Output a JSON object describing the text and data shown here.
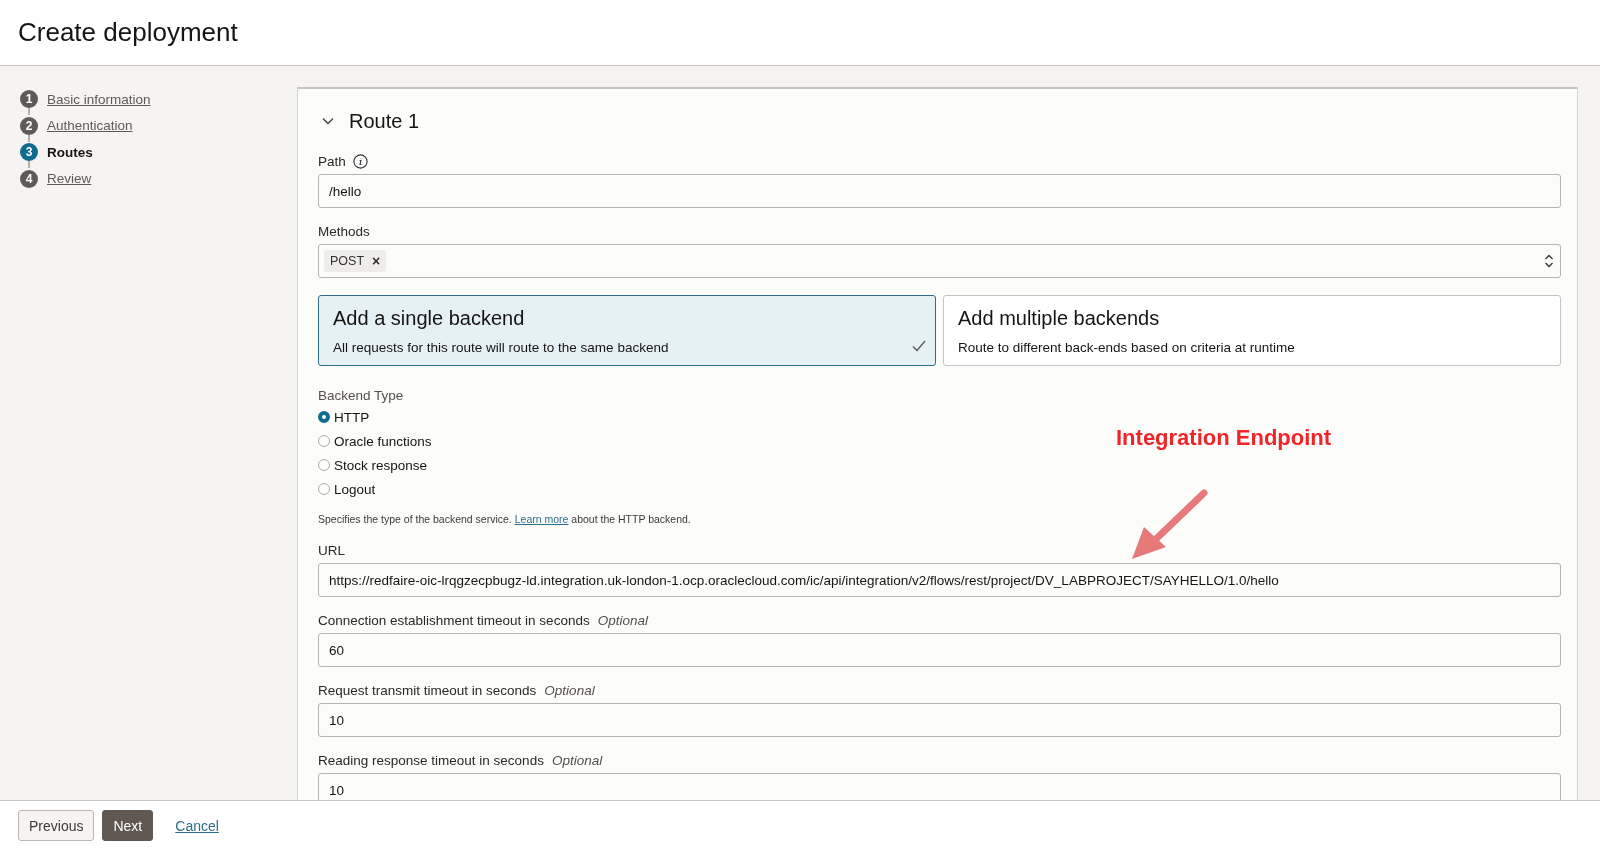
{
  "page": {
    "title": "Create deployment"
  },
  "steps": [
    {
      "number": "1",
      "label": "Basic information",
      "selected": false
    },
    {
      "number": "2",
      "label": "Authentication",
      "selected": false
    },
    {
      "number": "3",
      "label": "Routes",
      "selected": true
    },
    {
      "number": "4",
      "label": "Review",
      "selected": false
    }
  ],
  "route": {
    "title": "Route 1",
    "expanded": true,
    "path": {
      "label": "Path",
      "value": "/hello"
    },
    "methods": {
      "label": "Methods",
      "chips": [
        {
          "label": "POST",
          "remove": "×"
        }
      ]
    },
    "backend_options": [
      {
        "title": "Add a single backend",
        "description": "All requests for this route will route to the same backend",
        "selected": true
      },
      {
        "title": "Add multiple backends",
        "description": "Route to different back-ends based on criteria at runtime",
        "selected": false
      }
    ],
    "backend_type": {
      "label": "Backend Type",
      "options": [
        {
          "label": "HTTP",
          "selected": true
        },
        {
          "label": "Oracle functions",
          "selected": false
        },
        {
          "label": "Stock response",
          "selected": false
        },
        {
          "label": "Logout",
          "selected": false
        }
      ],
      "help_before": "Specifies the type of the backend service. ",
      "help_link": "Learn more",
      "help_after": " about the HTTP backend."
    },
    "url": {
      "label": "URL",
      "value": "https://redfaire-oic-lrqgzecpbugz-ld.integration.uk-london-1.ocp.oraclecloud.com/ic/api/integration/v2/flows/rest/project/DV_LABPROJECT/SAYHELLO/1.0/hello"
    },
    "timeouts": [
      {
        "label": "Connection establishment timeout in seconds",
        "optional": "Optional",
        "value": "60"
      },
      {
        "label": "Request transmit timeout in seconds",
        "optional": "Optional",
        "value": "10"
      },
      {
        "label": "Reading response timeout in seconds",
        "optional": "Optional",
        "value": "10"
      }
    ]
  },
  "annotation": {
    "text": "Integration Endpoint"
  },
  "footer": {
    "buttons": [
      {
        "label": "Previous",
        "kind": "secondary"
      },
      {
        "label": "Next",
        "kind": "primary"
      },
      {
        "label": "Cancel",
        "kind": "link"
      }
    ]
  }
}
